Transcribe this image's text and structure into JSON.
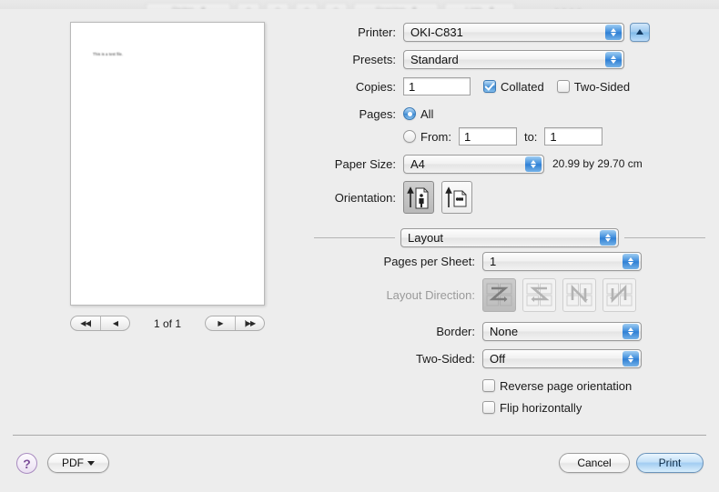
{
  "background_toolbar": {
    "items": [
      "Styles",
      "Spacing",
      "Lists"
    ]
  },
  "preview": {
    "page_text": "This is a test file.",
    "page_indicator": "1 of 1",
    "nav": {
      "first_label": "◀◀|",
      "prev_label": "◀",
      "next_label": "▶",
      "last_label": "|▶▶"
    }
  },
  "settings": {
    "printer": {
      "label": "Printer:",
      "value": "OKI-C831"
    },
    "presets": {
      "label": "Presets:",
      "value": "Standard"
    },
    "copies": {
      "label": "Copies:",
      "value": "1",
      "collated_label": "Collated",
      "collated_checked": true,
      "two_sided_label": "Two-Sided",
      "two_sided_checked": false
    },
    "pages": {
      "label": "Pages:",
      "all_label": "All",
      "all_selected": true,
      "from_label": "From:",
      "from_value": "1",
      "to_label": "to:",
      "to_value": "1"
    },
    "paper_size": {
      "label": "Paper Size:",
      "value": "A4",
      "measurement": "20.99 by 29.70 cm"
    },
    "orientation": {
      "label": "Orientation:",
      "portrait_selected": true,
      "landscape_selected": false
    }
  },
  "section": {
    "popup_value": "Layout"
  },
  "layout": {
    "pages_per_sheet": {
      "label": "Pages per Sheet:",
      "value": "1"
    },
    "layout_direction": {
      "label": "Layout Direction:",
      "options": [
        "z-pattern",
        "s-pattern",
        "reverse-n-pattern",
        "n-pattern"
      ],
      "selected_index": 0
    },
    "border": {
      "label": "Border:",
      "value": "None"
    },
    "two_sided": {
      "label": "Two-Sided:",
      "value": "Off"
    },
    "reverse_page_orientation": {
      "label": "Reverse page orientation",
      "checked": false
    },
    "flip_horizontally": {
      "label": "Flip horizontally",
      "checked": false
    }
  },
  "footer": {
    "help_label": "?",
    "pdf_label": "PDF",
    "cancel_label": "Cancel",
    "print_label": "Print"
  }
}
